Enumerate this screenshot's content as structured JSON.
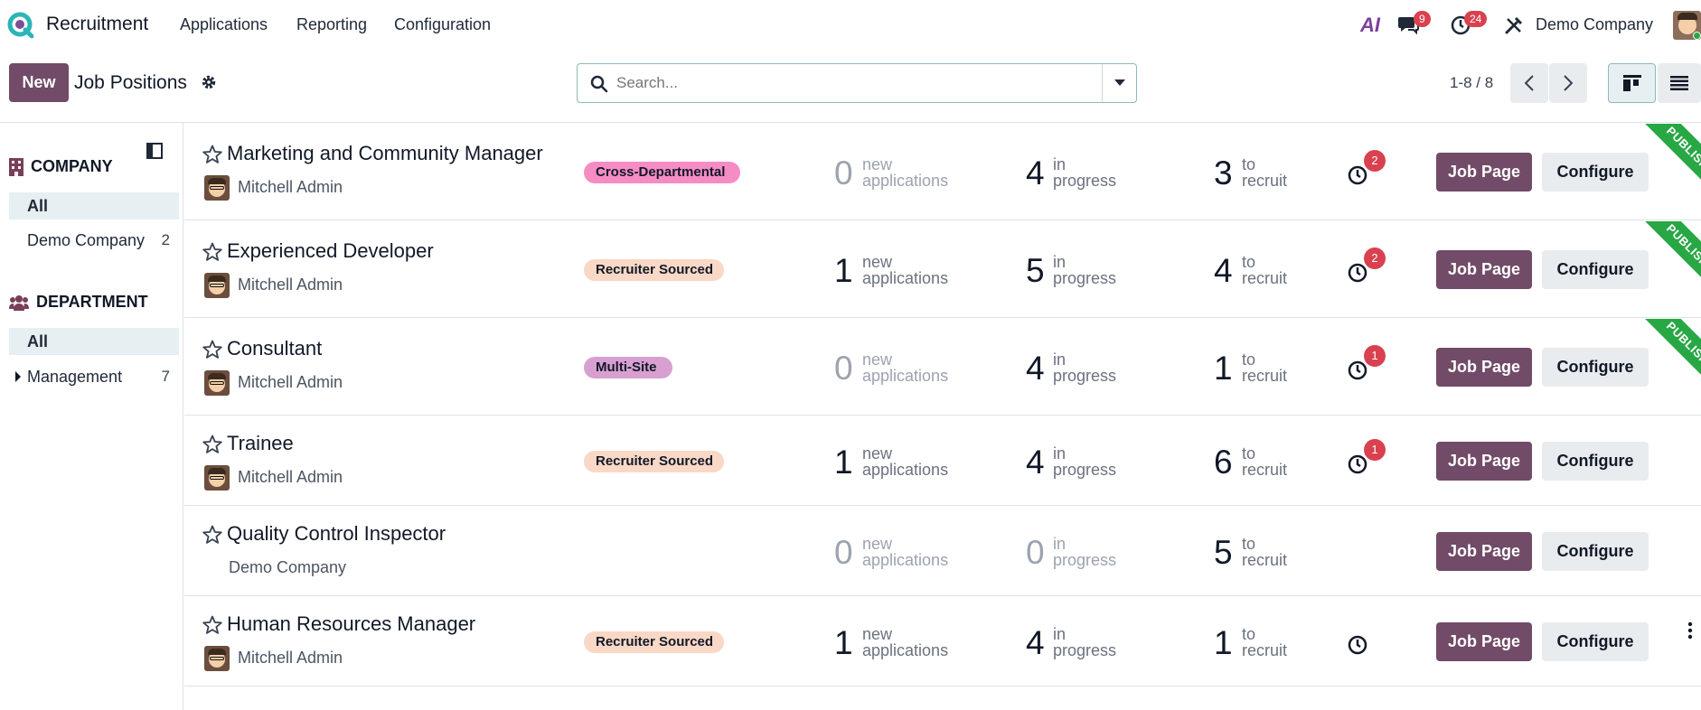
{
  "navbar": {
    "app_name": "Recruitment",
    "menus": [
      "Applications",
      "Reporting",
      "Configuration"
    ],
    "ai_label": "AI",
    "messages_badge": "9",
    "activities_badge": "24",
    "company": "Demo Company"
  },
  "control_panel": {
    "new_label": "New",
    "breadcrumb": "Job Positions",
    "search_placeholder": "Search...",
    "pager": "1-8 / 8"
  },
  "sidebar": {
    "company_header": "COMPANY",
    "company_items": [
      {
        "label": "All",
        "count": ""
      },
      {
        "label": "Demo Company",
        "count": "2"
      }
    ],
    "department_header": "DEPARTMENT",
    "department_items": [
      {
        "label": "All",
        "count": ""
      },
      {
        "label": "Management",
        "count": "7"
      }
    ]
  },
  "labels": {
    "new": "new",
    "applications": "applications",
    "in": "in",
    "progress": "progress",
    "to": "to",
    "recruit": "recruit",
    "job_page": "Job Page",
    "configure": "Configure",
    "published": "PUBLISHED"
  },
  "colors": {
    "primary": "#714b67",
    "tag_pink": "#f68cc4",
    "tag_peach": "#f9d8c6",
    "tag_purple": "#d8a0d0",
    "published": "#28a745",
    "badge_red": "#d9414f"
  },
  "jobs": [
    {
      "title": "Marketing and Community Manager",
      "owner": "Mitchell Admin",
      "tag": "Cross-Departmental",
      "new_apps": "0",
      "in_progress": "4",
      "to_recruit": "3",
      "activity_count": "2",
      "published": true
    },
    {
      "title": "Experienced Developer",
      "owner": "Mitchell Admin",
      "tag": "Recruiter Sourced",
      "new_apps": "1",
      "in_progress": "5",
      "to_recruit": "4",
      "activity_count": "2",
      "published": true
    },
    {
      "title": "Consultant",
      "owner": "Mitchell Admin",
      "tag": "Multi-Site",
      "new_apps": "0",
      "in_progress": "4",
      "to_recruit": "1",
      "activity_count": "1",
      "published": true
    },
    {
      "title": "Trainee",
      "owner": "Mitchell Admin",
      "tag": "Recruiter Sourced",
      "new_apps": "1",
      "in_progress": "4",
      "to_recruit": "6",
      "activity_count": "1",
      "published": false
    },
    {
      "title": "Quality Control Inspector",
      "owner": "Demo Company",
      "tag": "",
      "new_apps": "0",
      "in_progress": "0",
      "to_recruit": "5",
      "activity_count": "",
      "published": false
    },
    {
      "title": "Human Resources Manager",
      "owner": "Mitchell Admin",
      "tag": "Recruiter Sourced",
      "new_apps": "1",
      "in_progress": "4",
      "to_recruit": "1",
      "activity_count": "",
      "published": false
    }
  ]
}
